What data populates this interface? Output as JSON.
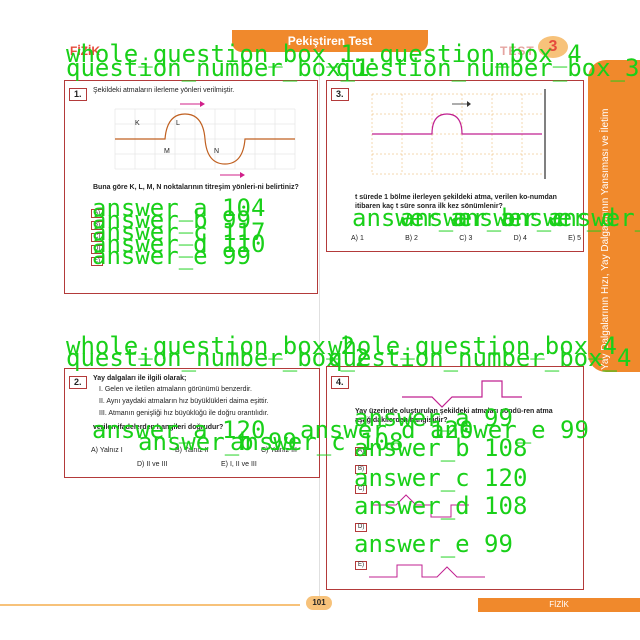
{
  "header": {
    "title": "Pekiştiren Test",
    "subject": "FİZİK",
    "test_label": "TEST",
    "test_number": "3"
  },
  "sidebar": {
    "text": "Yay Dalgalarının Hızı, Yay Dalgalarının Yansıması ve İletim"
  },
  "footer": {
    "page_number": "101",
    "subject": "FİZİK"
  },
  "questions": [
    {
      "number": "1.",
      "intro": "Şekildeki atmaların ilerleme yönleri verilmiştir.",
      "figure_labels": [
        "K",
        "L",
        "M",
        "N"
      ],
      "prompt": "Buna göre K, L, M, N noktalarının titreşim yönleri-ni belirtiniz?",
      "options": [
        "A)",
        "B)",
        "C)",
        "D)",
        "E)"
      ]
    },
    {
      "number": "2.",
      "intro": "Yay dalgaları ile ilgili olarak;",
      "items": [
        "I. Gelen ve iletilen atmaların görünümü benzerdir.",
        "II. Aynı yaydaki atmaların hız büyüklükleri daima eşittir.",
        "III. Atmanın genişliği hız büyüklüğü ile doğru orantılıdır."
      ],
      "prompt": "verilen ifadelerden hangileri doğrudur?",
      "options": [
        "A) Yalnız I",
        "B) Yalnız II",
        "C) Yalnız III",
        "D) II ve III",
        "E) I, II ve III"
      ]
    },
    {
      "number": "3.",
      "prompt": "t sürede 1 bölme ilerleyen şekildeki atma, verilen ko-numdan itibaren kaç t süre sonra ilk kez sönümlenir?",
      "options": [
        "A) 1",
        "B) 2",
        "C) 3",
        "D) 4",
        "E) 5"
      ]
    },
    {
      "number": "4.",
      "prompt": "Yay üzerinde oluşturulan şekildeki atmaları söndü-ren atma aşağıdakilerden hangisidir?",
      "options": [
        "A)",
        "B)",
        "C)",
        "D)",
        "E)"
      ]
    }
  ],
  "overlays": {
    "q1_box": "whole_question_box_1",
    "q1_num": "question_number_box_1",
    "q3_box": "whole_question_box_3",
    "q3_num": "question_number_box_3",
    "q3_tail": "...question_box_4",
    "q2_box": "whole_question_box_2",
    "q2_num": "question_number_box_2",
    "q4_box": "whole_question_box_4",
    "q4_num": "question_number_box_4",
    "q1_answers": [
      "answer_a 104",
      "answer_b 99",
      "answer_c 117",
      "answer_d 110",
      "answer_e 99"
    ],
    "q3_answers": [
      "answer_a",
      "answer_b",
      "answer_c",
      "answer_d",
      "answer_e"
    ],
    "q2_answers": [
      "answer_a 120",
      "answer_b 99",
      "answer_c 108",
      "answer_d 120",
      "answer_e 99"
    ],
    "q4_answers": [
      "answer_a 99",
      "answer_b 108",
      "answer_c 120",
      "answer_d 108",
      "answer_e 99"
    ]
  }
}
